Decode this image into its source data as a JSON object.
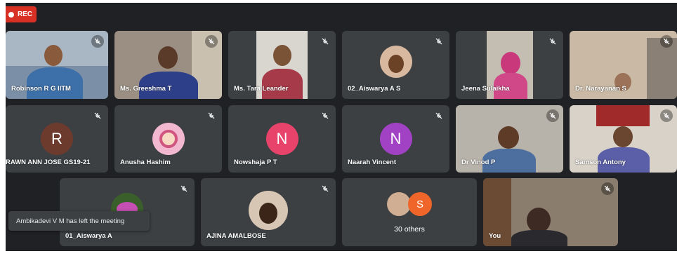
{
  "recording": {
    "label": "REC"
  },
  "participants": {
    "p1": {
      "name": "Robinson R G IITM"
    },
    "p2": {
      "name": "Ms. Greeshma T"
    },
    "p3": {
      "name": "Ms. Tara Leander"
    },
    "p4": {
      "name": "02_Aiswarya A S"
    },
    "p5": {
      "name": "Jeena Sulaikha"
    },
    "p6": {
      "name": "Dr. Narayanan S"
    },
    "p7": {
      "name": "RAWN ANN JOSE GS19-21",
      "initial": "R",
      "color": "#6d3b2e"
    },
    "p8": {
      "name": "Anusha Hashim"
    },
    "p9": {
      "name": "Nowshaja P T",
      "initial": "N",
      "color": "#e8436b"
    },
    "p10": {
      "name": "Naarah Vincent",
      "initial": "N",
      "color": "#a142c4"
    },
    "p11": {
      "name": "Dr Vinod P"
    },
    "p12": {
      "name": "Samson Antony"
    },
    "p13": {
      "name": "01_Aiswarya A"
    },
    "p14": {
      "name": "AJINA AMALBOSE"
    },
    "p16": {
      "name": "You"
    }
  },
  "others": {
    "label": "30 others",
    "initial": "S",
    "color": "#f06529"
  },
  "notification": {
    "text": "Ambikadevi V M has left the meeting"
  },
  "icons": {
    "mute": "mic-off-icon",
    "record": "record-dot-icon"
  }
}
